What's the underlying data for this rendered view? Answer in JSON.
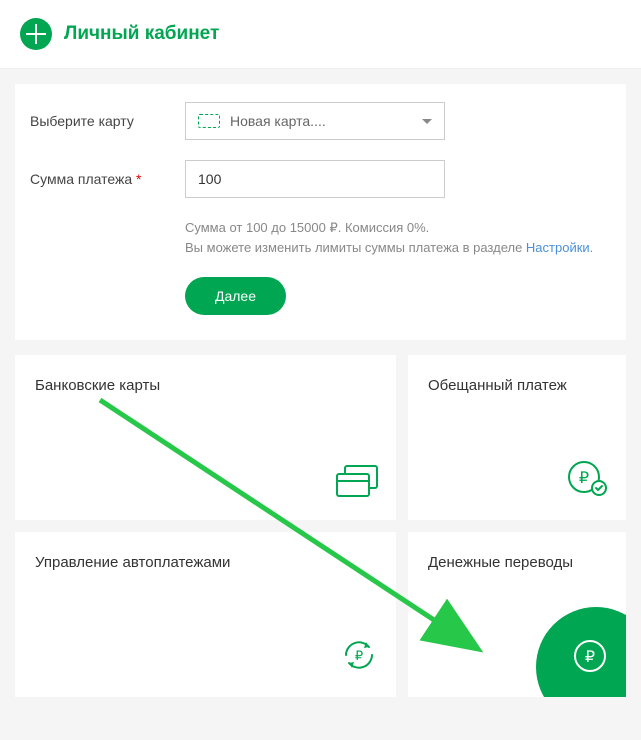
{
  "header": {
    "title": "Личный кабинет"
  },
  "form": {
    "card_label": "Выберите карту",
    "card_select_text": "Новая карта....",
    "amount_label": "Сумма платежа",
    "amount_value": "100",
    "hint_line1": "Сумма от 100 до 15000 ₽. Комиссия 0%.",
    "hint_line2_prefix": "Вы можете изменить лимиты суммы платежа в разделе ",
    "hint_link": "Настройки",
    "submit_label": "Далее"
  },
  "tiles": {
    "bank_cards": "Банковские карты",
    "promised_payment": "Обещанный платеж",
    "autopay": "Управление автоплатежами",
    "transfers": "Денежные переводы"
  }
}
